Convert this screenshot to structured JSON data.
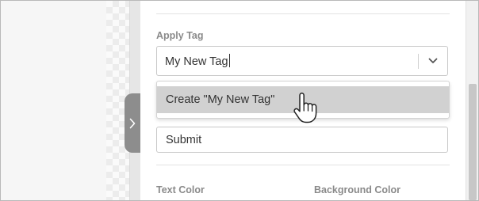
{
  "apply_tag": {
    "label": "Apply Tag",
    "input_value": "My New Tag",
    "menu": {
      "create_option": "Create \"My New Tag\""
    }
  },
  "submit_field": {
    "value": "Submit"
  },
  "colors_section": {
    "text_color_label": "Text Color",
    "background_color_label": "Background Color"
  },
  "icons": {
    "collapse_handle": "chevron-right-icon",
    "dropdown": "chevron-down-icon",
    "cursor": "hand-pointer-icon"
  },
  "theme": {
    "highlight": "#d1d1d1",
    "handle": "#8d8d8d",
    "label_text": "#8a8a8a"
  }
}
